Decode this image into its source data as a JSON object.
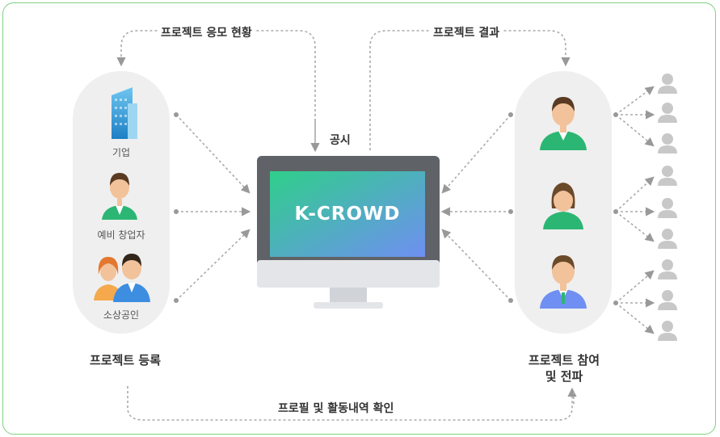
{
  "arrows": {
    "top_left": "프로젝트 응모 현황",
    "top_right": "프로젝트 결과",
    "bottom": "프로필 및 활동내역 확인",
    "notice": "공시"
  },
  "left_group": {
    "items": [
      {
        "label": "기업",
        "icon": "building-icon"
      },
      {
        "label": "예비 창업자",
        "icon": "person-icon"
      },
      {
        "label": "소상공인",
        "icon": "couple-icon"
      }
    ],
    "caption": "프로젝트 등록"
  },
  "center": {
    "screen_text": "K-CROWD"
  },
  "right_group": {
    "caption_line1": "프로젝트 참여",
    "caption_line2": "및 전파"
  },
  "colors": {
    "frame": "#7ed07e",
    "pill": "#efefef",
    "screen_gradient_start": "#2fcf8a",
    "screen_gradient_end": "#6f8ff2"
  }
}
